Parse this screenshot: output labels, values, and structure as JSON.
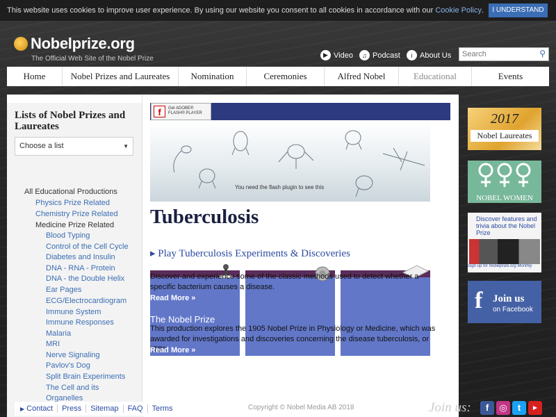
{
  "cookie": {
    "text": "This website uses cookies to improve user experience. By using our website you consent to all cookies in accordance with our",
    "policy_link": "Cookie Policy",
    "period": ".",
    "button": "I UNDERSTAND"
  },
  "header": {
    "logo_name": "Nobelprize.org",
    "tagline": "The Official Web Site of the Nobel Prize",
    "video": "Video",
    "podcast": "Podcast",
    "about": "About Us",
    "search_placeholder": "Search"
  },
  "nav": [
    "Home",
    "Nobel Prizes and Laureates",
    "Nomination",
    "Ceremonies",
    "Alfred Nobel",
    "Educational",
    "Events"
  ],
  "sidebar": {
    "heading": "Lists of Nobel Prizes and Laureates",
    "select_value": "Choose a list",
    "items": [
      "All Educational Productions",
      "Physics Prize Related",
      "Chemistry Prize Related",
      "Medicine Prize Related",
      "Blood Typing",
      "Control of the Cell Cycle",
      "Diabetes and Insulin",
      "DNA - RNA - Protein",
      "DNA - the Double Helix",
      "Ear Pages",
      "ECG/Electrocardiogram",
      "Immune System",
      "Immune Responses",
      "Malaria",
      "MRI",
      "Nerve Signaling",
      "Pavlov's Dog",
      "Split Brain Experiments",
      "The Cell and its",
      "Organelles"
    ]
  },
  "flash": {
    "get_line1": "Get ADOBE®",
    "get_line2": "FLASH® PLAYER",
    "message": "You need the flash plugin to see this"
  },
  "main": {
    "title": "Tuberculosis",
    "play_link": "Play Tuberculosis Experiments & Discoveries",
    "para1": "Discover and experience some of the classic methods used to detect whether a specific bacterium causes a disease.",
    "read_more1": "Read More »",
    "section2_title": "The Nobel Prize",
    "para2": "This production explores the 1905 Nobel Prize in Physiology or Medicine, which was awarded for investigations and discoveries concerning the disease tuberculosis, or \"TB\".",
    "read_more2": "Read More »"
  },
  "right": {
    "laureates_year": "2017",
    "laureates_label": "Nobel Laureates",
    "women_label": "NOBEL WOMEN",
    "discover_text": "Discover features and trivia about the Nobel Prize",
    "signup_text": "Sign up for Nobelprize.org Monthly",
    "facebook_line1": "Join us",
    "facebook_line2": "on Facebook"
  },
  "footer": {
    "links": [
      "Contact",
      "Press",
      "Sitemap",
      "FAQ",
      "Terms"
    ],
    "copyright": "Copyright © Nobel Media AB 2018",
    "join_us": "Join us:"
  },
  "colors": {
    "accent_blue": "#3b6eb4",
    "tile_blue": "#6277c8",
    "tile_head": "#5a2d5a",
    "flash_bar": "#2d3a80",
    "facebook": "#4461a5"
  }
}
